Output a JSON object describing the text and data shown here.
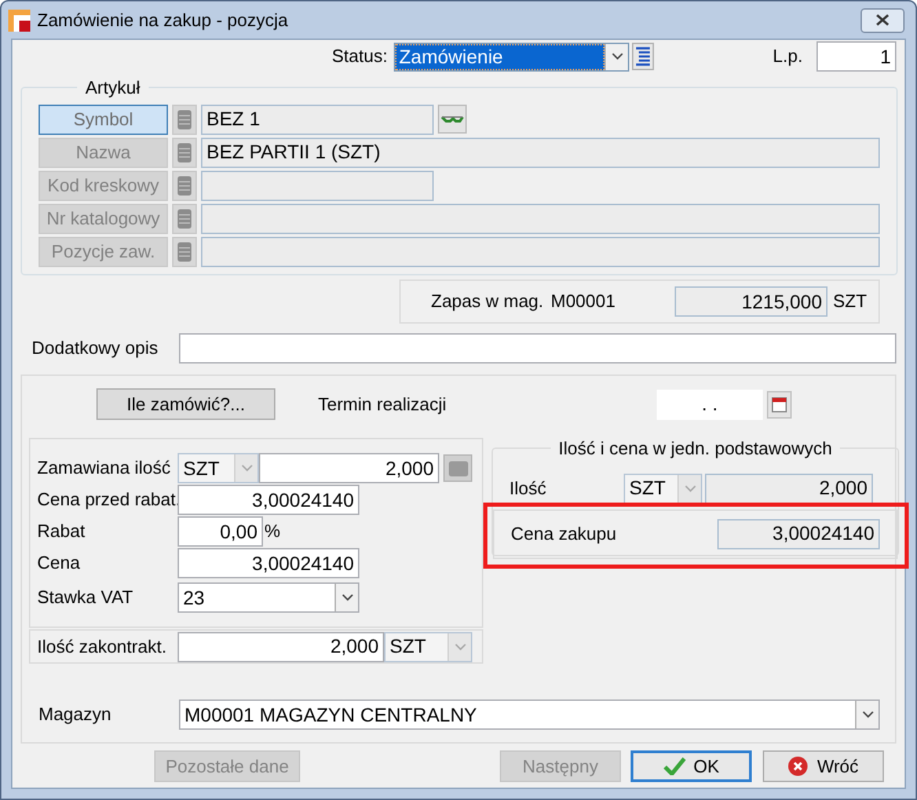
{
  "window": {
    "title": "Zamówienie na zakup - pozycja"
  },
  "status": {
    "label": "Status:",
    "value": "Zamówienie"
  },
  "lp": {
    "label": "L.p.",
    "value": "1"
  },
  "article": {
    "legend": "Artykuł",
    "fields": [
      {
        "label": "Symbol",
        "value": "BEZ 1",
        "selected": true,
        "wide": false
      },
      {
        "label": "Nazwa",
        "value": "BEZ PARTII 1 (SZT)",
        "selected": false,
        "wide": true
      },
      {
        "label": "Kod kreskowy",
        "selected": false,
        "wide": false
      },
      {
        "label": "Nr katalogowy",
        "selected": false,
        "wide": true
      },
      {
        "label": "Pozycje zaw.",
        "selected": false,
        "wide": true
      }
    ]
  },
  "stock": {
    "label": "Zapas w mag.",
    "warehouse": "M00001",
    "value": "1215,000",
    "unit": "SZT"
  },
  "description": {
    "label": "Dodatkowy opis"
  },
  "how_many_button": "Ile zamówić?...",
  "deadline": {
    "label": "Termin realizacji",
    "value": ".  ."
  },
  "order": {
    "quantity_label": "Zamawiana ilość",
    "unit": "SZT",
    "quantity": "2,000",
    "price_before_label": "Cena przed rabat.",
    "price_before": "3,00024140",
    "discount_label": "Rabat",
    "discount": "0,00",
    "discount_unit": "%",
    "price_label": "Cena",
    "price": "3,00024140",
    "vat_label": "Stawka VAT",
    "vat": "23"
  },
  "base_units": {
    "legend": "Ilość i cena w jedn. podstawowych",
    "quantity_label": "Ilość",
    "unit": "SZT",
    "quantity": "2,000",
    "price_label": "Cena zakupu",
    "price": "3,00024140",
    "highlighted": true
  },
  "contracted": {
    "label": "Ilość zakontrakt.",
    "value": "2,000",
    "unit": "SZT"
  },
  "warehouse": {
    "label": "Magazyn",
    "value": "M00001 MAGAZYN CENTRALNY"
  },
  "buttons": [
    {
      "label": "Pozostałe dane",
      "kind": "plain",
      "disabled": true
    },
    {
      "label": "Następny",
      "kind": "plain",
      "disabled": true
    },
    {
      "label": "OK",
      "kind": "ok",
      "disabled": false
    },
    {
      "label": "Wróć",
      "kind": "back",
      "disabled": false
    }
  ]
}
